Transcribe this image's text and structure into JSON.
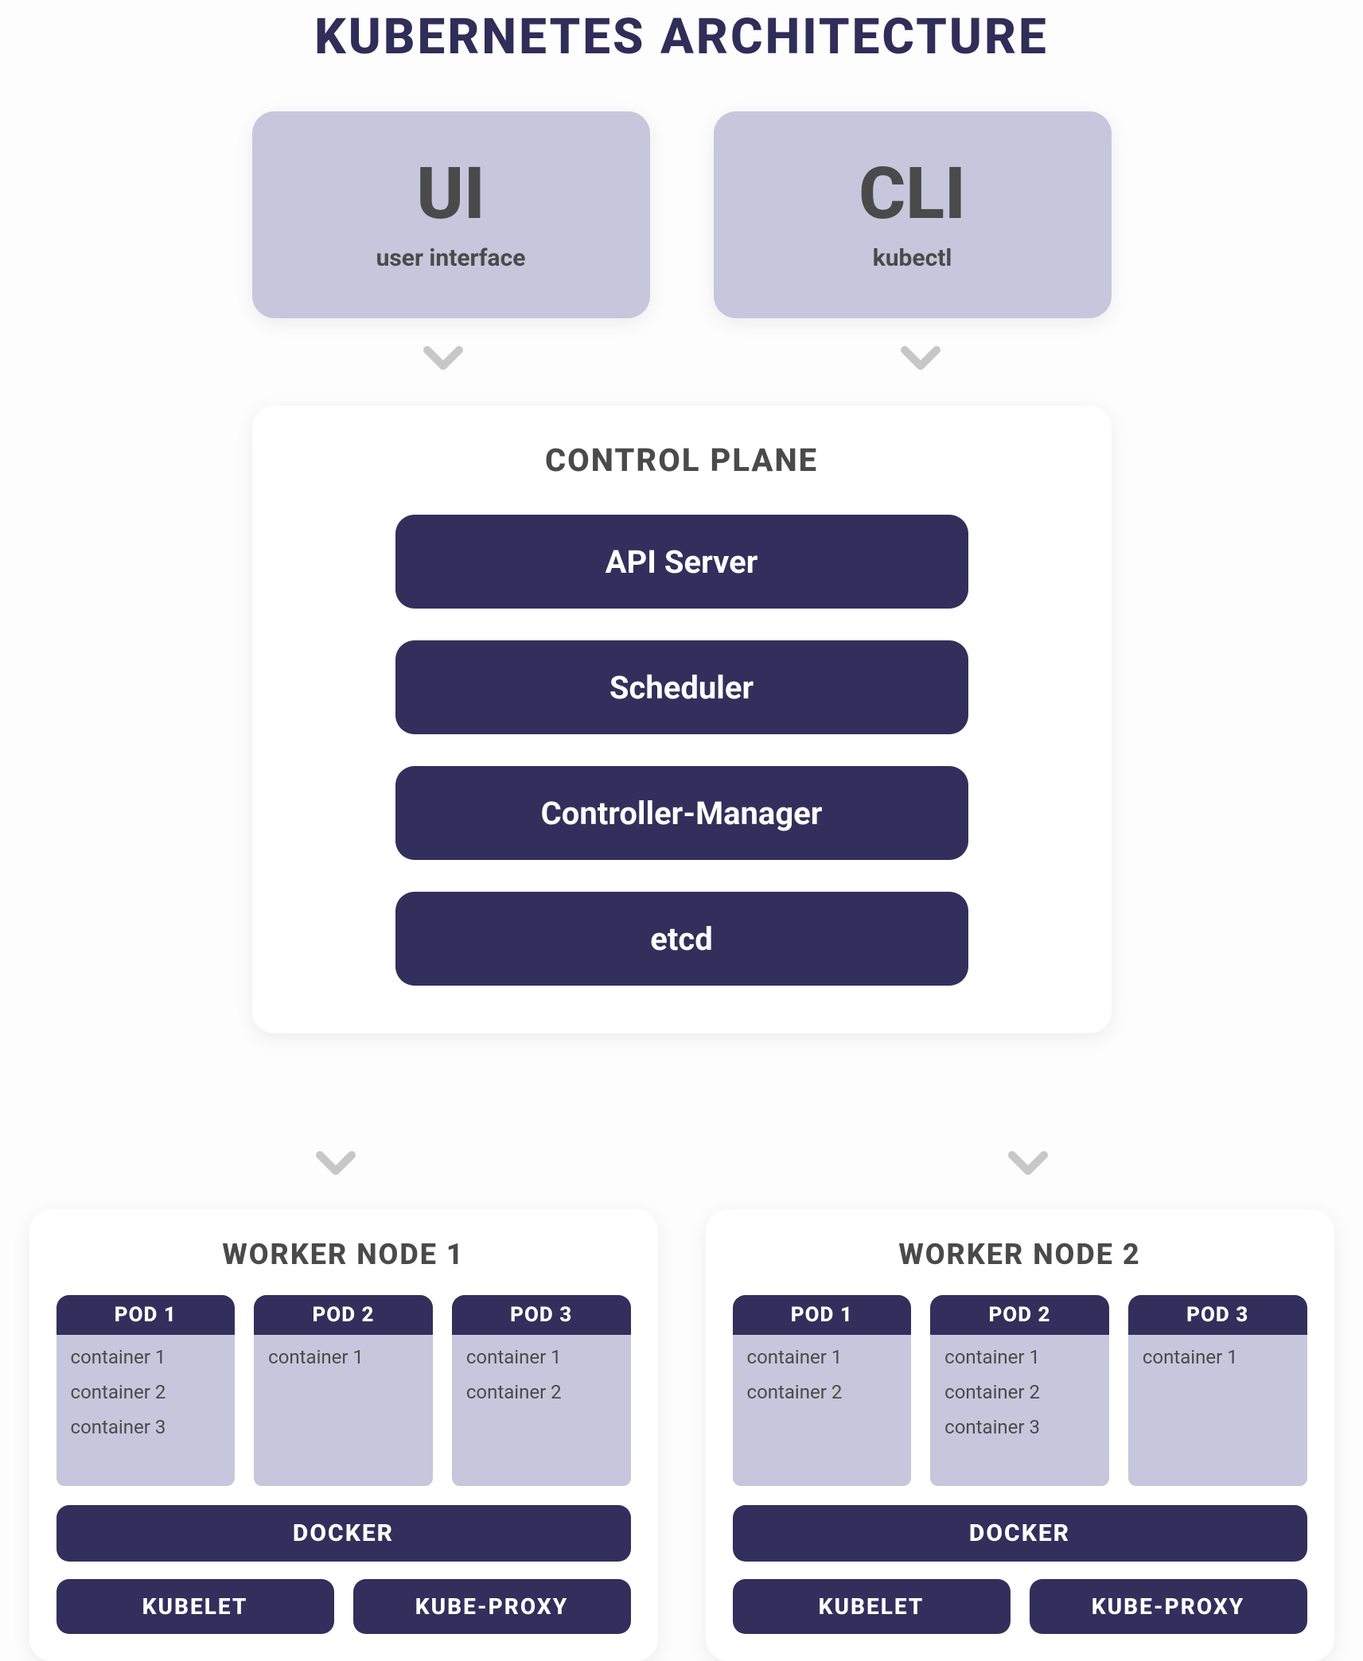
{
  "title": "KUBERNETES ARCHITECTURE",
  "entry": {
    "ui": {
      "big": "UI",
      "small": "user interface"
    },
    "cli": {
      "big": "CLI",
      "small": "kubectl"
    }
  },
  "control_plane": {
    "title": "CONTROL PLANE",
    "items": [
      "API Server",
      "Scheduler",
      "Controller-Manager",
      "etcd"
    ]
  },
  "workers": [
    {
      "title": "WORKER NODE 1",
      "pods": [
        {
          "name": "POD 1",
          "containers": [
            "container 1",
            "container 2",
            "container 3"
          ]
        },
        {
          "name": "POD 2",
          "containers": [
            "container 1"
          ]
        },
        {
          "name": "POD 3",
          "containers": [
            "container 1",
            "container 2"
          ]
        }
      ],
      "runtime": "DOCKER",
      "agents": [
        "KUBELET",
        "KUBE-PROXY"
      ]
    },
    {
      "title": "WORKER NODE 2",
      "pods": [
        {
          "name": "POD 1",
          "containers": [
            "container 1",
            "container 2"
          ]
        },
        {
          "name": "POD 2",
          "containers": [
            "container 1",
            "container 2",
            "container 3"
          ]
        },
        {
          "name": "POD 3",
          "containers": [
            "container 1"
          ]
        }
      ],
      "runtime": "DOCKER",
      "agents": [
        "KUBELET",
        "KUBE-PROXY"
      ]
    }
  ]
}
